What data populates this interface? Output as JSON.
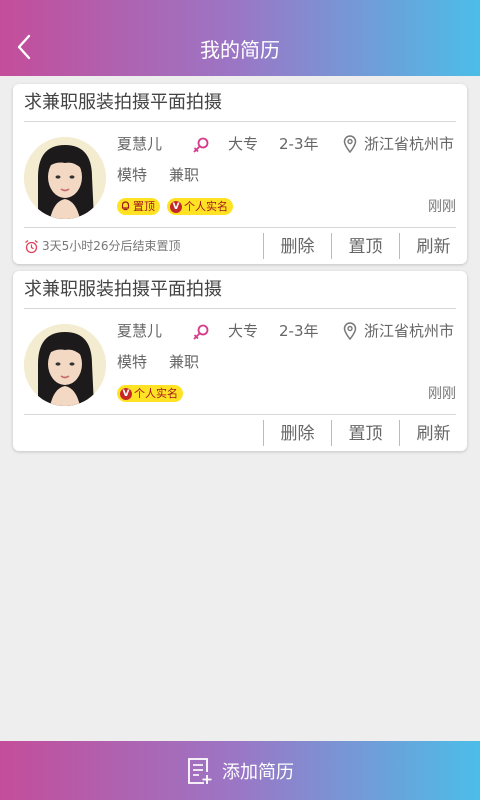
{
  "header": {
    "title": "我的简历",
    "back_icon": "chevron-left-icon"
  },
  "resumes": [
    {
      "title": "求兼职服装拍摄平面拍摄",
      "name": "夏慧儿",
      "gender_icon": "female-icon",
      "education": "大专",
      "experience": "2-3年",
      "location": "浙江省杭州市",
      "tags": [
        "模特",
        "兼职"
      ],
      "badges": [
        "置顶",
        "个人实名"
      ],
      "time": "刚刚",
      "countdown": "3天5小时26分后结束置顶",
      "actions": [
        "删除",
        "置顶",
        "刷新"
      ]
    },
    {
      "title": "求兼职服装拍摄平面拍摄",
      "name": "夏慧儿",
      "gender_icon": "female-icon",
      "education": "大专",
      "experience": "2-3年",
      "location": "浙江省杭州市",
      "tags": [
        "模特",
        "兼职"
      ],
      "badges": [
        "个人实名"
      ],
      "time": "刚刚",
      "actions": [
        "删除",
        "置顶",
        "刷新"
      ]
    }
  ],
  "footer": {
    "label": "添加简历",
    "icon": "add-document-icon"
  },
  "colors": {
    "gradient_start": "#c44d9a",
    "gradient_end": "#4cbde8",
    "badge_bg": "#ffe224",
    "badge_text": "#a0181c",
    "gender_icon": "#d63a8a"
  }
}
